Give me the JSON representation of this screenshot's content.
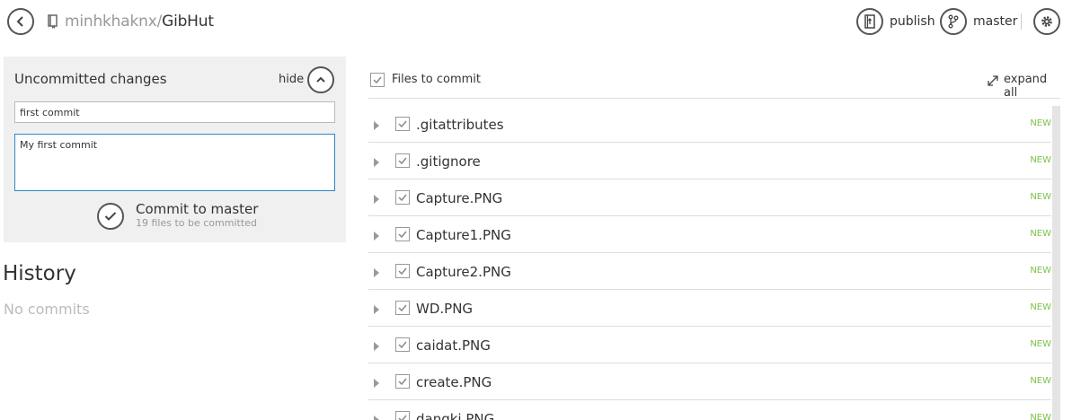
{
  "header": {
    "repo_owner": "minhkhaknx",
    "repo_separator": "/",
    "repo_name": "GibHut",
    "publish_label": "publish",
    "branch_label": "master"
  },
  "commit_panel": {
    "title": "Uncommitted changes",
    "hide_label": "hide",
    "summary_value": "first commit",
    "description_value": "My first commit",
    "commit_label": "Commit to master",
    "commit_sub": "19 files to be committed"
  },
  "history": {
    "title": "History",
    "empty_text": "No commits"
  },
  "files": {
    "title": "Files to commit",
    "expand_label": "expand all",
    "items": [
      {
        "name": ".gitattributes",
        "status": "NEW"
      },
      {
        "name": ".gitignore",
        "status": "NEW"
      },
      {
        "name": "Capture.PNG",
        "status": "NEW"
      },
      {
        "name": "Capture1.PNG",
        "status": "NEW"
      },
      {
        "name": "Capture2.PNG",
        "status": "NEW"
      },
      {
        "name": "WD.PNG",
        "status": "NEW"
      },
      {
        "name": "caidat.PNG",
        "status": "NEW"
      },
      {
        "name": "create.PNG",
        "status": "NEW"
      },
      {
        "name": "dangki.PNG",
        "status": "NEW"
      }
    ]
  },
  "colors": {
    "accent": "#2b8acb",
    "new_status": "#7dc24b",
    "panel_bg": "#f0f0f0"
  }
}
